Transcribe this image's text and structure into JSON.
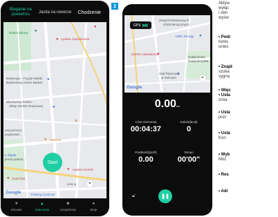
{
  "screen1": {
    "tabs": [
      "Bieganie na powietrzu",
      "Jazda na rowerze",
      "Chodzenie"
    ],
    "map_labels": {
      "dolina": "Dolina Silnicy",
      "apteka1": "Apteka Całodobowa",
      "barbecjan": "Barbecjan - Fryzjer Męski",
      "barbershop": "Barbershop Kielce Barber",
      "bikefactory": "Bikefactory Kielce -",
      "bikefactory2": "Sklep Serwis Rowerowy",
      "pizza": "10Pizza",
      "pomocy": "wej pomocy",
      "pogotowie": "pogotowie...",
      "slaski": "a Śląski",
      "slaski2": "jenne pasma...",
      "hotel": "Hotel Dal",
      "apteka2": "Apteka Gemini",
      "umc": "Umc p",
      "parking": "Parking Centrum"
    },
    "google": "Google",
    "start_label": "Start",
    "nav": [
      "Zdrowie",
      "Ćwiczenie",
      "Urządzenia",
      "Moje"
    ]
  },
  "step_badge": "2",
  "screen2": {
    "gps_label": "GPS",
    "map_labels": {
      "szkoly": "Zespół Państwowych",
      "szkoly2": "Szkół Muzycznych",
      "amic": "AMIC Energy",
      "apteka": "Apteka Całodobowa",
      "polit": "Politechnika",
      "polit2": "Świętokrzyska",
      "sad": "Sąd Rejonowy",
      "sad2": "w Kielcach"
    },
    "google": "Google",
    "distance_value": "0.00",
    "distance_unit": "km",
    "time_label": "Czas ćwiczenia",
    "time_value": "00:04:37",
    "calories_label": "Kalorie(kcal)",
    "calories_value": "0",
    "speed_label": "Prędkość(km/h)",
    "speed_value": "0.00",
    "pace_label": "Tempo",
    "pace_value": "00'00\""
  },
  "right_text": [
    "Aktyw",
    "wyłąc",
    "i obn",
    "wyśw",
    "• Podr",
    "funkc",
    "unies",
    "• Znajd",
    "szuka",
    "sygna",
    "• Więc",
    "• Usta",
    "zmia",
    "• Usta",
    "pozi",
    "• Usta",
    "Kon",
    "• Wyb",
    "Moż",
    "• Res",
    "• Adr"
  ]
}
